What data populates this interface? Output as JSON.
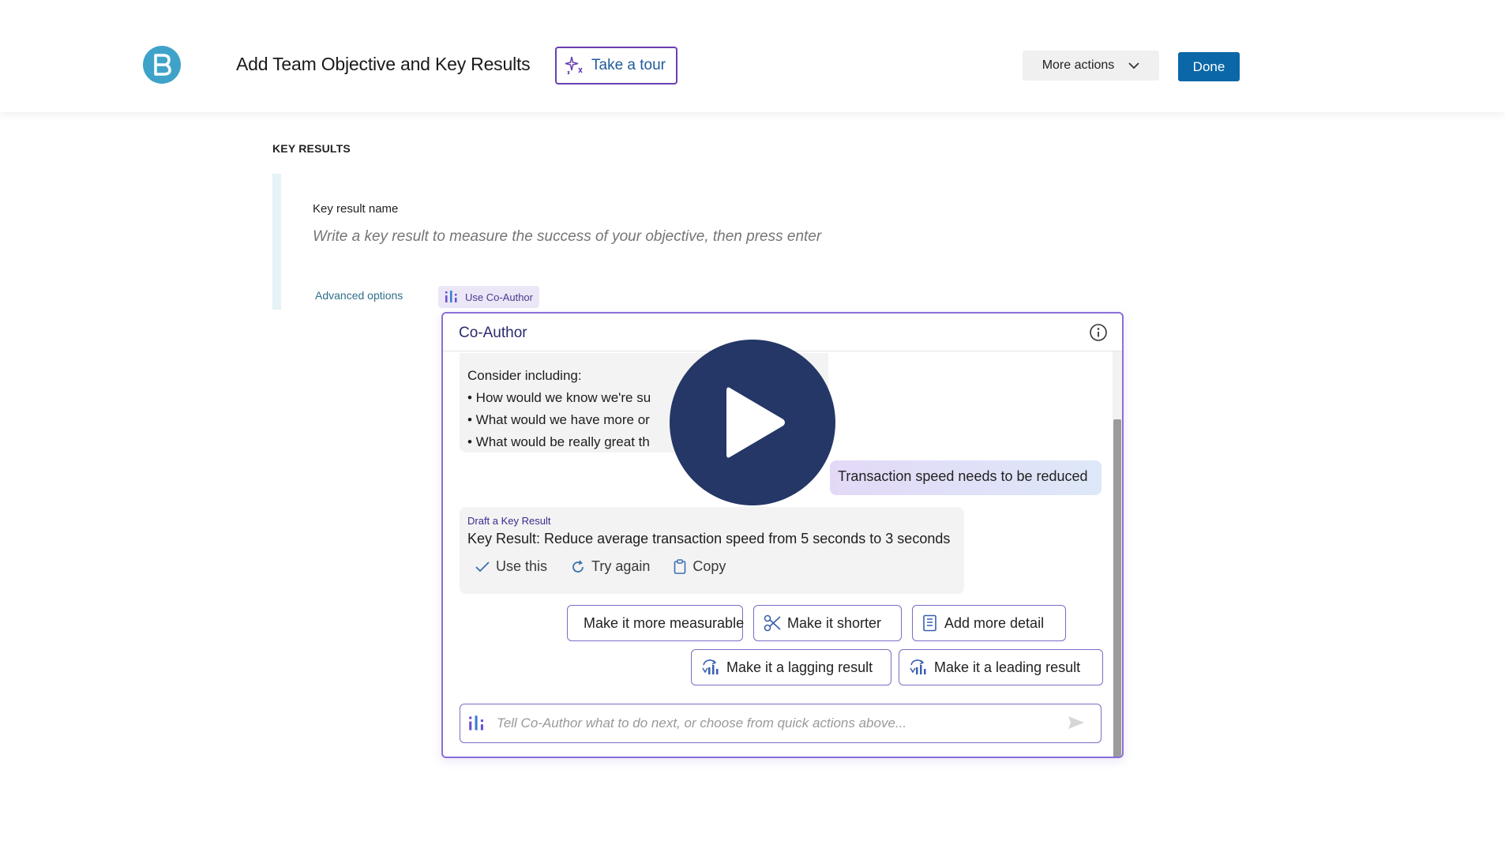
{
  "header": {
    "title": "Add Team Objective and Key Results",
    "tour_label": "Take a tour",
    "more_actions_label": "More actions",
    "done_label": "Done"
  },
  "section": {
    "title": "KEY RESULTS",
    "key_result_name_label": "Key result name",
    "key_result_placeholder": "Write a key result to measure the success of your objective, then press enter",
    "advanced_options_label": "Advanced options",
    "use_coauthor_label": "Use Co-Author"
  },
  "coauthor": {
    "title": "Co-Author",
    "consider_heading": "Consider including:",
    "consider_items": [
      "• How would we know we're su",
      "• What would we have more or",
      "• What would be really great th"
    ],
    "user_message": "Transaction speed needs to be reduced",
    "draft": {
      "label": "Draft a Key Result",
      "text": "Key Result: Reduce average transaction speed from 5 seconds to 3 seconds",
      "use_this": "Use this",
      "try_again": "Try again",
      "copy": "Copy"
    },
    "quick_actions": [
      "Make it more measurable",
      "Make it shorter",
      "Add more detail",
      "Make it a lagging result",
      "Make it a leading result"
    ],
    "composer_placeholder": "Tell Co-Author what to do next, or choose from quick actions above..."
  },
  "colors": {
    "accent_purple": "#7b6cc7",
    "done_blue": "#0b67a8",
    "logo_blue": "#3fa3c9",
    "play_navy": "#243766"
  }
}
